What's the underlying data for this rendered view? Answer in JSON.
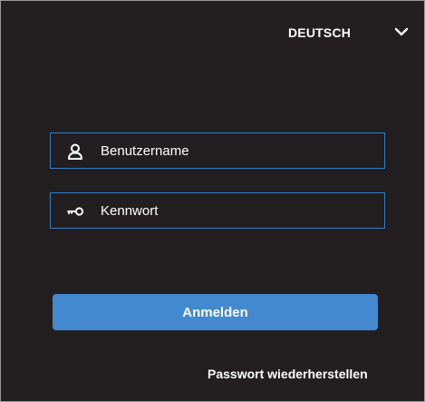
{
  "language": {
    "selected": "DEUTSCH",
    "icon": "chevron-down-icon"
  },
  "form": {
    "username": {
      "placeholder": "Benutzername",
      "value": "",
      "icon": "user-icon"
    },
    "password": {
      "placeholder": "Kennwort",
      "value": "",
      "icon": "key-icon"
    },
    "submit_label": "Anmelden",
    "reset_link_label": "Passwort wiederherstellen"
  },
  "colors": {
    "background": "#231f20",
    "accent": "#4289cf",
    "field_border": "#2f7fcc",
    "text": "#ffffff"
  }
}
